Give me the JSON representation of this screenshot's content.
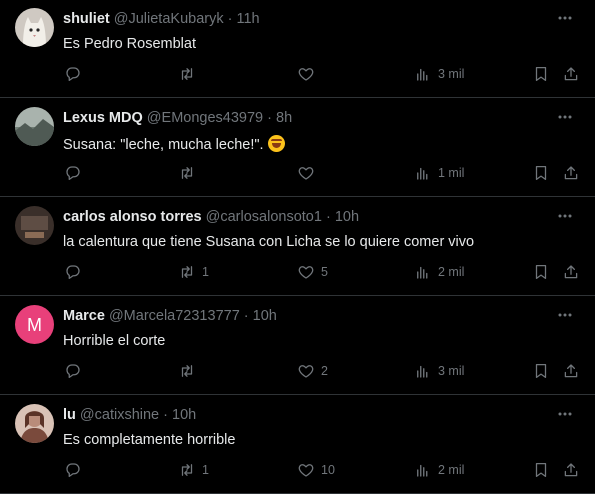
{
  "tweets": [
    {
      "name": "shuliet",
      "handle": "@JulietaKubaryk",
      "time": "11h",
      "text": "Es Pedro Rosemblat",
      "emoji": false,
      "avatar_icon": "cat-avatar",
      "avatar_color": "#cfc9c2",
      "replies": "",
      "retweets": "",
      "likes": "",
      "views": "3 mil"
    },
    {
      "name": "Lexus MDQ",
      "handle": "@EMonges43979",
      "time": "8h",
      "text": "Susana: \"leche, mucha leche!\".",
      "emoji": true,
      "avatar_icon": "landscape-avatar",
      "avatar_color": "#6f7c74",
      "replies": "",
      "retweets": "",
      "likes": "",
      "views": "1 mil"
    },
    {
      "name": "carlos alonso torres",
      "handle": "@carlosalonsoto1",
      "time": "10h",
      "text": "la calentura que tiene Susana con Licha se lo quiere comer vivo",
      "emoji": false,
      "avatar_icon": "dark-photo-avatar",
      "avatar_color": "#3a2f2a",
      "replies": "",
      "retweets": "1",
      "likes": "5",
      "views": "2 mil"
    },
    {
      "name": "Marce",
      "handle": "@Marcela72313777",
      "time": "10h",
      "text": "Horrible el corte",
      "emoji": false,
      "avatar_icon": "letter-avatar",
      "avatar_letter": "M",
      "avatar_color": "#e8407a",
      "replies": "",
      "retweets": "",
      "likes": "2",
      "views": "3 mil"
    },
    {
      "name": "lu",
      "handle": "@catixshine",
      "time": "10h",
      "text": "Es completamente horrible",
      "emoji": false,
      "avatar_icon": "portrait-avatar",
      "avatar_color": "#b98c7a",
      "replies": "",
      "retweets": "1",
      "likes": "10",
      "views": "2 mil"
    }
  ],
  "separator": "·"
}
